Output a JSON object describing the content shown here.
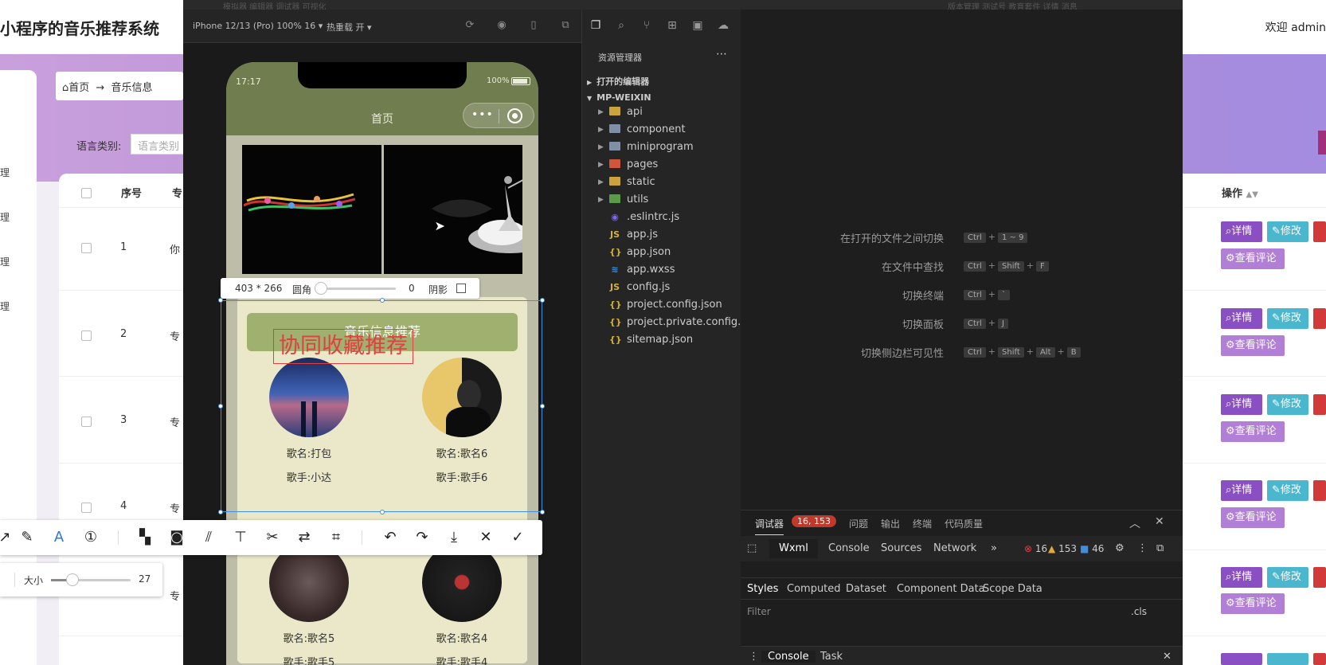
{
  "admin": {
    "title": "小程序的音乐推荐系统",
    "welcome": "欢迎 admin",
    "breadcrumb": {
      "home": "首页",
      "arrow": "→",
      "current": "音乐信息"
    },
    "filter": {
      "label": "语言类别:",
      "placeholder": "语言类别"
    },
    "columns": {
      "index": "序号",
      "cut": "专",
      "actions": "操作"
    },
    "rows": [
      {
        "index": "1",
        "cut": "你"
      },
      {
        "index": "2",
        "cut": "专"
      },
      {
        "index": "3",
        "cut": "专"
      },
      {
        "index": "4",
        "cut": "专"
      },
      {
        "index": "",
        "cut": "专"
      }
    ],
    "side_cut": [
      "理",
      "理",
      "理",
      "理"
    ],
    "actions": {
      "detail": "详情",
      "edit": "修改",
      "comment": "查看评论"
    }
  },
  "devtools": {
    "top_menu": "模拟器   编辑器   调试器   可视化",
    "top_menu_right": "版本管理   测试号   教育套件   详情   消息",
    "device": "iPhone 12/13 (Pro) 100% 16 ▾",
    "hot_reload": "热重载 开 ▾"
  },
  "phone": {
    "time": "17:17",
    "battery": "100%",
    "title": "首页",
    "recommend_header": "音乐信息推荐",
    "songs": [
      {
        "name": "歌名:打包",
        "artist": "歌手:小达"
      },
      {
        "name": "歌名:歌名6",
        "artist": "歌手:歌手6"
      },
      {
        "name": "歌名:歌名5",
        "artist": "歌手:歌手5"
      },
      {
        "name": "歌名:歌名4",
        "artist": "歌手:歌手4"
      }
    ]
  },
  "screenshot_tool": {
    "dimensions": "403 * 266",
    "radius_label": "圆角",
    "radius_value": "0",
    "shadow_label": "阴影",
    "annotation_text": "协同收藏推荐",
    "size_label": "大小",
    "size_value": "27",
    "size_fraction": 0.27,
    "radius_fraction": 0,
    "icons": [
      "arrow-icon",
      "pen-icon",
      "text-icon",
      "number-icon",
      "mosaic-icon",
      "blur-icon",
      "hatch-icon",
      "pin-icon",
      "cut-icon",
      "translate-icon",
      "ocr-icon",
      "undo-icon",
      "redo-icon",
      "download-icon",
      "close-icon",
      "confirm-icon"
    ]
  },
  "explorer": {
    "title": "资源管理器",
    "open_editors": "打开的编辑器",
    "project": "MP-WEIXIN",
    "folders": [
      "api",
      "component",
      "miniprogram",
      "pages",
      "static",
      "utils"
    ],
    "files": [
      ".eslintrc.js",
      "app.js",
      "app.json",
      "app.wxss",
      "config.js",
      "project.config.json",
      "project.private.config.js...",
      "sitemap.json"
    ]
  },
  "editor_hints": [
    {
      "label": "在打开的文件之间切换",
      "keys": [
        "Ctrl",
        "1 ~ 9"
      ]
    },
    {
      "label": "在文件中查找",
      "keys": [
        "Ctrl",
        "Shift",
        "F"
      ]
    },
    {
      "label": "切换终端",
      "keys": [
        "Ctrl",
        "`"
      ]
    },
    {
      "label": "切换面板",
      "keys": [
        "Ctrl",
        "J"
      ]
    },
    {
      "label": "切换侧边栏可见性",
      "keys": [
        "Ctrl",
        "Shift",
        "Alt",
        "B"
      ]
    }
  ],
  "debugger": {
    "tabs": [
      "调试器",
      "问题",
      "输出",
      "终端",
      "代码质量"
    ],
    "badge": "16, 153",
    "subtabs": [
      "Wxml",
      "Console",
      "Sources",
      "Network"
    ],
    "more": "»",
    "errors": "16",
    "warnings": "153",
    "infos": "46",
    "panel_tabs": [
      "Styles",
      "Computed",
      "Dataset",
      "Component Data",
      "Scope Data"
    ],
    "filter": "Filter",
    "cls": ".cls",
    "bottom_tabs": [
      "Console",
      "Task"
    ]
  },
  "colors": {
    "phone_header": "#6f7d4f",
    "recommend_header": "#9fb06f",
    "annotation": "#e04040",
    "selection": "#3d8fe0",
    "detail_button": "#8a4fc2",
    "edit_button": "#4bb7cf",
    "comment_button": "#b27fd6"
  }
}
